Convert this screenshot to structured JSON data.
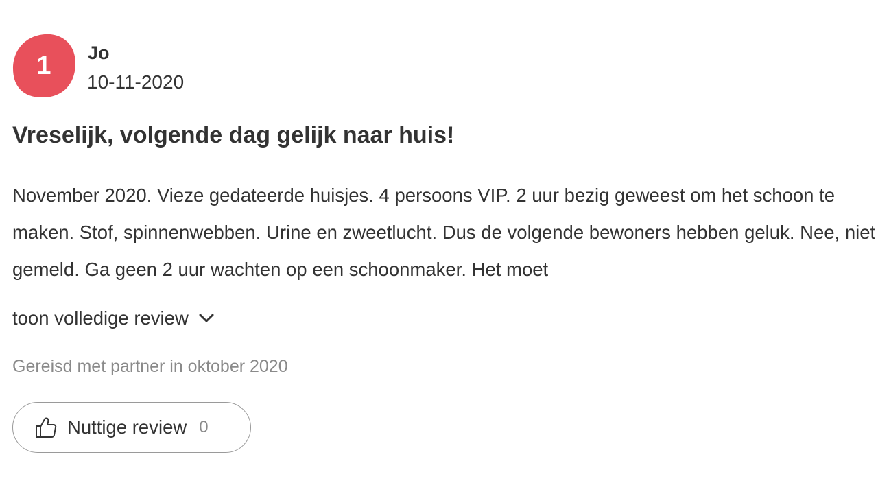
{
  "review": {
    "score": "1",
    "score_color": "#e8505b",
    "reviewer_name": "Jo",
    "date": "10-11-2020",
    "title": "Vreselijk, volgende dag gelijk naar huis!",
    "body": "November 2020. Vieze gedateerde huisjes. 4 persoons VIP. 2 uur bezig geweest om het schoon te maken. Stof, spinnenwebben. Urine en zweetlucht. Dus de volgende bewoners hebben geluk. Nee, niet gemeld. Ga geen 2 uur wachten op een schoonmaker. Het moet",
    "toggle_label": "toon volledige review",
    "toggle_icon": "chevron-down-icon",
    "travel_info": "Gereisd met partner in oktober 2020",
    "helpful": {
      "label": "Nuttige review",
      "count": "0",
      "icon": "thumbs-up-icon"
    }
  }
}
